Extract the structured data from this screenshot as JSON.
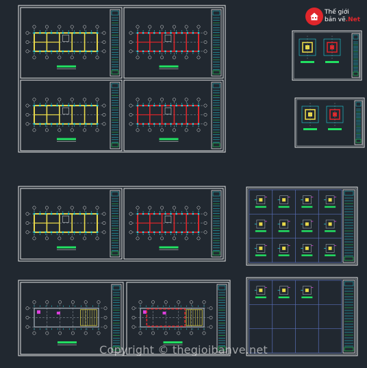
{
  "logo": {
    "line1": "Thế giới",
    "line2_a": "bản vẽ",
    "line2_b": ".Net"
  },
  "watermark": "Copyright © thegioibanve.net",
  "colors": {
    "background": "#212830",
    "frame": "#e8e8e8",
    "grid": "#9aa3ad",
    "walls_yellow": "#e8d84a",
    "walls_red": "#d8252a",
    "cyan": "#22d3e0",
    "green": "#22e062",
    "magenta": "#e040e0",
    "blue": "#5a6fb8"
  },
  "drawings": {
    "plan_sheets": [
      {
        "id": "sheet-1",
        "variant": "yellow"
      },
      {
        "id": "sheet-2",
        "variant": "red"
      },
      {
        "id": "sheet-3",
        "variant": "yellow"
      },
      {
        "id": "sheet-4",
        "variant": "red"
      },
      {
        "id": "sheet-5",
        "variant": "yellow"
      },
      {
        "id": "sheet-6",
        "variant": "red"
      },
      {
        "id": "sheet-7",
        "variant": "furnished"
      },
      {
        "id": "sheet-8",
        "variant": "furnished-red"
      }
    ],
    "detail_sheets": [
      {
        "id": "detail-sheet-1"
      },
      {
        "id": "detail-sheet-2"
      }
    ],
    "column_detail_sheets": [
      {
        "id": "column-sheet-1",
        "cells_filled": 12
      },
      {
        "id": "column-sheet-2",
        "cells_filled": 3
      }
    ]
  }
}
